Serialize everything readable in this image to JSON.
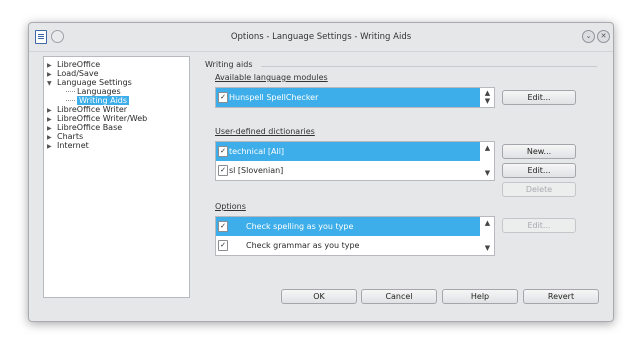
{
  "window": {
    "title": "Options - Language Settings - Writing Aids",
    "minimize_glyph": "⌄",
    "close_glyph": "✕"
  },
  "tree": {
    "items": [
      {
        "label": "LibreOffice",
        "expander": "▶"
      },
      {
        "label": "Load/Save",
        "expander": "▶"
      },
      {
        "label": "Language Settings",
        "expander": "▼"
      },
      {
        "label": "Languages",
        "expander": ""
      },
      {
        "label": "Writing Aids",
        "expander": ""
      },
      {
        "label": "LibreOffice Writer",
        "expander": "▶"
      },
      {
        "label": "LibreOffice Writer/Web",
        "expander": "▶"
      },
      {
        "label": "LibreOffice Base",
        "expander": "▶"
      },
      {
        "label": "Charts",
        "expander": "▶"
      },
      {
        "label": "Internet",
        "expander": "▶"
      }
    ],
    "selected": "Writing Aids"
  },
  "writing_aids": {
    "group_title": "Writing aids",
    "modules": {
      "label": "Available language modules",
      "items": [
        {
          "label": "Hunspell SpellChecker",
          "checked": true,
          "selected": true
        }
      ],
      "edit_button": "Edit..."
    },
    "dictionaries": {
      "label": "User-defined dictionaries",
      "items": [
        {
          "label": "technical [All]",
          "checked": true,
          "selected": true
        },
        {
          "label": "sl [Slovenian]",
          "checked": true,
          "selected": false
        }
      ],
      "new_button": "New...",
      "edit_button": "Edit...",
      "delete_button": "Delete"
    },
    "options": {
      "label": "Options",
      "items": [
        {
          "label": "Check spelling as you type",
          "checked": true,
          "selected": true
        },
        {
          "label": "Check grammar as you type",
          "checked": true,
          "selected": false
        }
      ],
      "edit_button": "Edit..."
    }
  },
  "footer": {
    "ok": "OK",
    "cancel": "Cancel",
    "help": "Help",
    "revert": "Revert"
  },
  "colors": {
    "selection": "#3daee9",
    "dialog_bg": "#e6e7e9"
  },
  "icons": {
    "checkbox_mark": "✓",
    "scroll_up": "▲",
    "scroll_down": "▼"
  }
}
